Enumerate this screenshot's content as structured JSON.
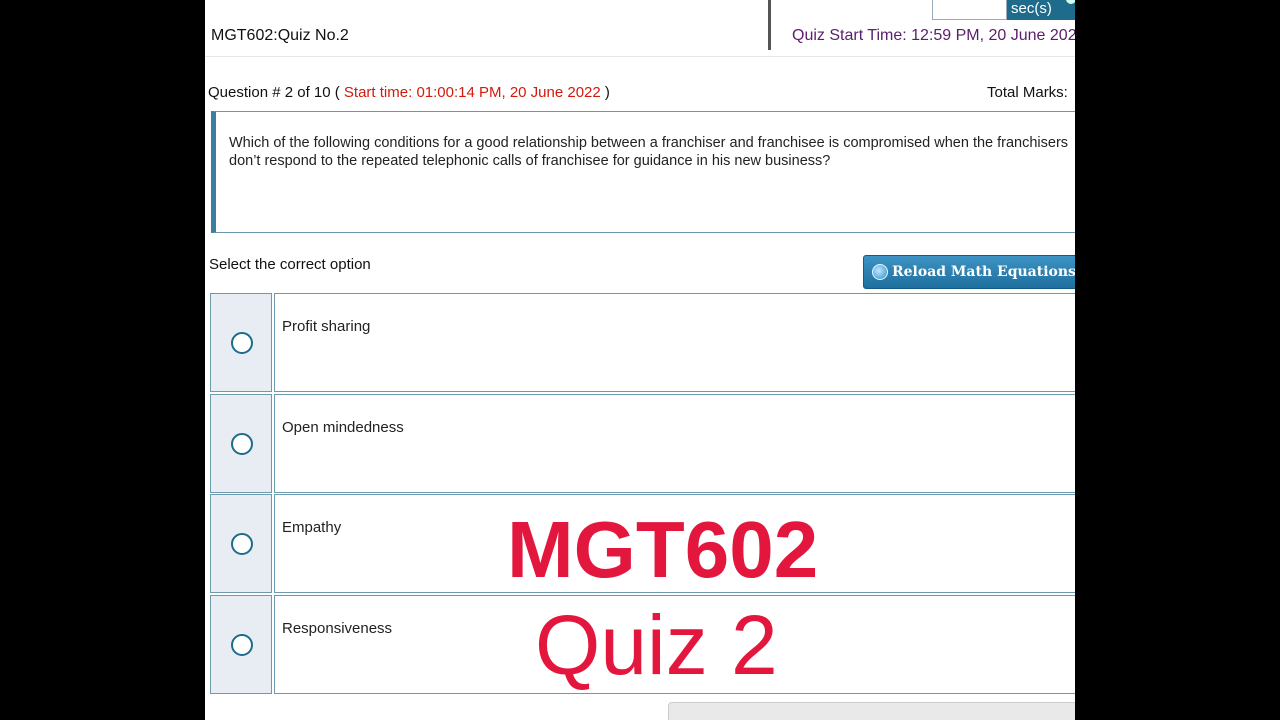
{
  "header": {
    "quiz_title": "MGT602:Quiz No.2",
    "quiz_start": "Quiz Start Time: 12:59 PM, 20 June 202",
    "timer_unit": "sec(s)"
  },
  "question": {
    "number_prefix": "Question # 2 of 10 ( ",
    "start_time": "Start time: 01:00:14 PM, 20 June 2022",
    "number_suffix": " )",
    "total_marks": "Total Marks:",
    "text": "Which of the following conditions for a good relationship between a franchiser and franchisee is compromised when the franchisers don’t respond to the repeated telephonic calls of franchisee for guidance in his new business?"
  },
  "select_label": "Select the correct option",
  "reload_button": "Reload Math Equations",
  "options": [
    {
      "label": "Profit sharing"
    },
    {
      "label": "Open mindedness"
    },
    {
      "label": "Empathy"
    },
    {
      "label": "Responsiveness"
    }
  ],
  "overlay": {
    "line1": "MGT602",
    "line2": "Quiz 2"
  },
  "colors": {
    "accent": "#1f6b8c",
    "start_time_red": "#d21a0c",
    "overlay_red": "#e3173e",
    "quiz_start_purple": "#5b1e6a"
  }
}
